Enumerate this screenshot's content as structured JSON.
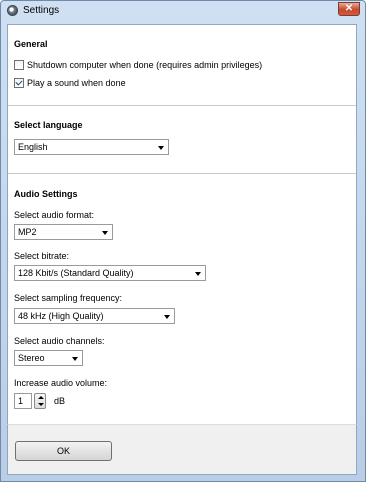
{
  "window": {
    "title": "Settings"
  },
  "general": {
    "heading": "General",
    "shutdown_label": "Shutdown computer when done (requires admin privileges)",
    "shutdown_checked": false,
    "sound_label": "Play a sound when done",
    "sound_checked": true
  },
  "language": {
    "heading": "Select language",
    "selected": "English"
  },
  "audio": {
    "heading": "Audio Settings",
    "format_label": "Select audio format:",
    "format_value": "MP2",
    "bitrate_label": "Select bitrate:",
    "bitrate_value": "128 Kbit/s (Standard Quality)",
    "sampling_label": "Select sampling frequency:",
    "sampling_value": "48 kHz (High Quality)",
    "channels_label": "Select audio channels:",
    "channels_value": "Stereo",
    "volume_label": "Increase audio volume:",
    "volume_value": "1",
    "volume_unit": "dB"
  },
  "footer": {
    "ok_label": "OK"
  }
}
